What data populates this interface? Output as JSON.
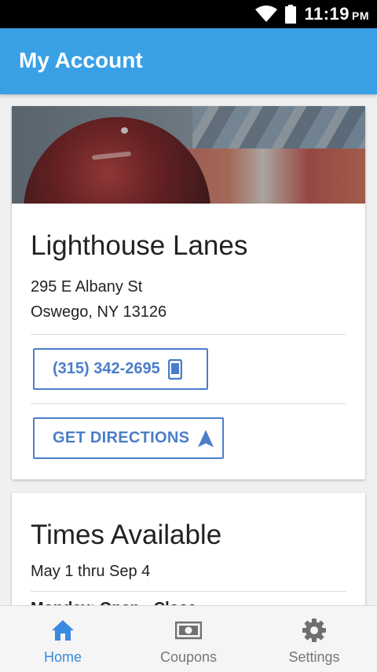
{
  "status_bar": {
    "time": "11:19",
    "ampm": "PM"
  },
  "app_bar": {
    "title": "My Account"
  },
  "venue": {
    "name": "Lighthouse Lanes",
    "address_line1": "295 E Albany St",
    "address_line2": "Oswego, NY 13126",
    "phone_label": "(315) 342-2695",
    "directions_label": "GET DIRECTIONS"
  },
  "times": {
    "title": "Times Available",
    "range": "May 1 thru Sep 4",
    "next_line": "Monday: Open - Close"
  },
  "bottom_nav": {
    "items": [
      {
        "label": "Home",
        "icon": "home-icon",
        "active": true
      },
      {
        "label": "Coupons",
        "icon": "money-icon",
        "active": false
      },
      {
        "label": "Settings",
        "icon": "gear-icon",
        "active": false
      }
    ]
  },
  "colors": {
    "app_bar": "#39a0e6",
    "accent": "#4a7ec9",
    "nav_active": "#3a8ae0"
  }
}
